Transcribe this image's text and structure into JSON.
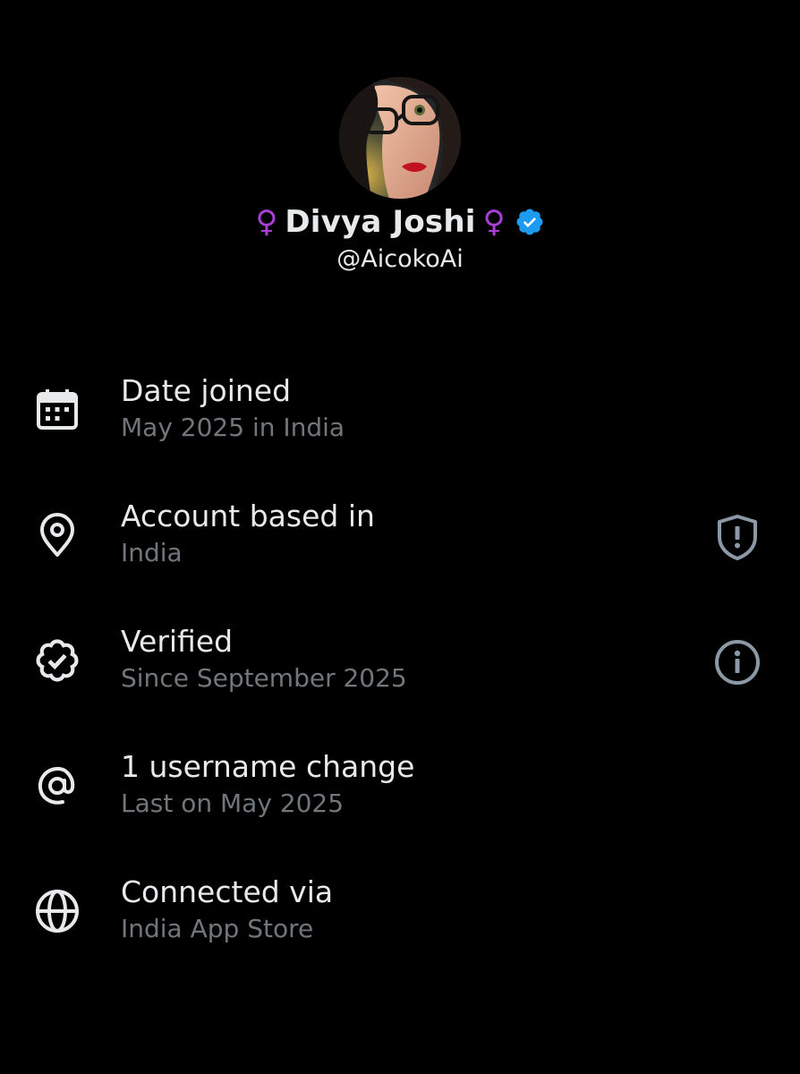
{
  "profile": {
    "display_name": "Divya Joshi",
    "name_prefix_emoji": "♀",
    "name_suffix_emoji": "♀",
    "emoji_color": "#a93fd6",
    "handle": "@AicokoAi",
    "verified": true,
    "verified_badge_color": "#1d9bf0"
  },
  "info_rows": [
    {
      "icon": "calendar-icon",
      "title": "Date joined",
      "subtitle": "May 2025 in India",
      "action_icon": null
    },
    {
      "icon": "location-pin-icon",
      "title": "Account based in",
      "subtitle": "India",
      "action_icon": "shield-alert-icon"
    },
    {
      "icon": "verified-check-icon",
      "title": "Verified",
      "subtitle": "Since September 2025",
      "action_icon": "info-icon"
    },
    {
      "icon": "at-sign-icon",
      "title": "1 username change",
      "subtitle": "Last on May 2025",
      "action_icon": null
    },
    {
      "icon": "globe-icon",
      "title": "Connected via",
      "subtitle": "India App Store",
      "action_icon": null
    }
  ],
  "colors": {
    "background": "#000000",
    "primary_text": "#e7e9ea",
    "secondary_text": "#71767b"
  }
}
